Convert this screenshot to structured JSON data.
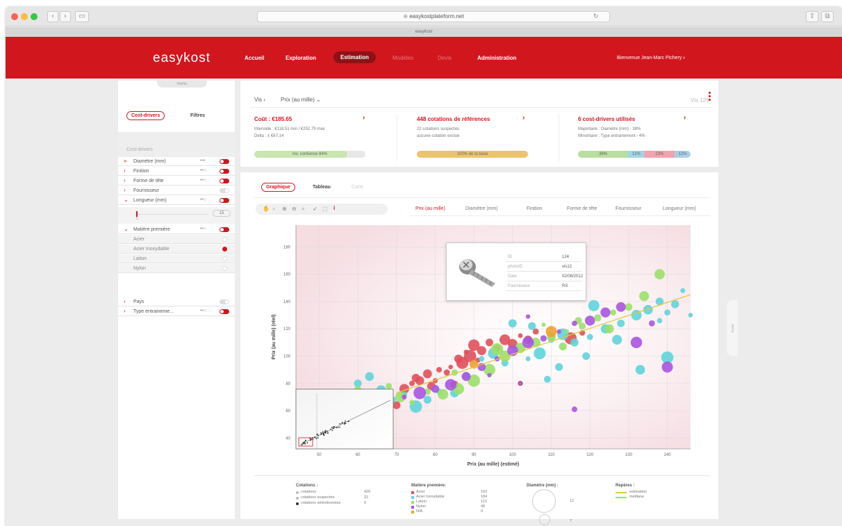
{
  "browser": {
    "url": "easykostplateform.net",
    "tab_title": "easyKost"
  },
  "header": {
    "logo": "easykost",
    "nav": [
      {
        "label": "Accueil",
        "state": "normal"
      },
      {
        "label": "Exploration",
        "state": "normal"
      },
      {
        "label": "Estimation",
        "state": "active"
      },
      {
        "label": "Modèles",
        "state": "disabled"
      },
      {
        "label": "Devis",
        "state": "disabled"
      },
      {
        "label": "Administration",
        "state": "normal"
      }
    ],
    "welcome": "Bienvenue Jean-Marc Pichery"
  },
  "left_panel": {
    "menu_tab": "menu",
    "tabs": {
      "cost_drivers": "Cost-drivers",
      "filters": "Filtres"
    },
    "section_title": "Cost-drivers",
    "drivers": [
      {
        "label": "Diamètre (mm)",
        "toggle": true,
        "dots": "•••"
      },
      {
        "label": "Finition",
        "toggle": true,
        "dots": "••○"
      },
      {
        "label": "Forme de tête",
        "toggle": true,
        "dots": "••○"
      },
      {
        "label": "Fournisseur",
        "toggle": false,
        "dots": ""
      },
      {
        "label": "Longueur (mm)",
        "toggle": true,
        "dots": "••○"
      }
    ],
    "range_min": "5",
    "range_max": "15",
    "material": {
      "label": "Matière première",
      "dots": "••○",
      "options": [
        {
          "label": "Acier",
          "selected": false
        },
        {
          "label": "Acier Inoxydable",
          "selected": true
        },
        {
          "label": "Laiton",
          "selected": false
        },
        {
          "label": "Nylon",
          "selected": false
        }
      ]
    },
    "drivers_after": [
      {
        "label": "Pays",
        "toggle": false,
        "dots": ""
      },
      {
        "label": "Type entraineme...",
        "toggle": true,
        "dots": "••○"
      }
    ]
  },
  "summary": {
    "breadcrumb_root": "Vis",
    "breadcrumb_current": "Prix (au mille)",
    "item_label": "Vis 125",
    "cost": {
      "title": "Coût : €185.65",
      "line1": "Intervalle : €118,51 min / €252,79 max",
      "line2": "Delta : ± €67,14",
      "bar": "niv. confiance 84%",
      "confidence": 84
    },
    "quotes": {
      "title": "448 cotations de références",
      "line1": "22 cotations suspectes",
      "line2": "aucune cotation exclue",
      "bar": "100% de la base"
    },
    "drivers": {
      "title": "6 cost-drivers utilisés",
      "line1": "Majoritaire : Diamètre (mm) - 38%",
      "line2": "Minoritaire : Type entrainement - 4%",
      "segments": [
        {
          "label": "38%",
          "share": 38,
          "color": "#b8dea0"
        },
        {
          "label": "12%",
          "share": 12,
          "color": "#9fd6e8"
        },
        {
          "label": "23%",
          "share": 23,
          "color": "#f1a3ad"
        },
        {
          "label": "12%",
          "share": 12,
          "color": "#a9cfe8"
        }
      ]
    }
  },
  "graph": {
    "view_tabs": [
      "Graphique",
      "Tableau",
      "Carte"
    ],
    "column_tabs": [
      "Prix (au mille)",
      "Diamètre (mm)",
      "Finition",
      "Forme de tête",
      "Fournisseur",
      "Longueur (mm)"
    ],
    "side_handle": "menu",
    "tooltip": {
      "rows": [
        {
          "key": "ID",
          "value": "124"
        },
        {
          "key": "photoID",
          "value": "vis12"
        },
        {
          "key": "Date",
          "value": "02/08/2012"
        },
        {
          "key": "Fournisseur",
          "value": "RS"
        }
      ]
    }
  },
  "chart_data": {
    "type": "scatter",
    "xlabel": "Prix (au mille) (estimé)",
    "ylabel": "Prix (au mille) (réel)",
    "xlim": [
      44,
      146
    ],
    "ylim": [
      32,
      196
    ],
    "xticks": [
      50,
      60,
      70,
      80,
      90,
      100,
      110,
      120,
      130,
      140
    ],
    "yticks": [
      40,
      60,
      80,
      100,
      120,
      140,
      160,
      180
    ],
    "grid": true,
    "trend_line": {
      "x": [
        70,
        146
      ],
      "y": [
        73,
        145
      ]
    },
    "series": [
      {
        "name": "Acier",
        "color": "#e0505a",
        "points": [
          [
            75,
            84
          ],
          [
            78,
            87
          ],
          [
            80,
            82
          ],
          [
            83,
            88
          ],
          [
            85,
            79
          ],
          [
            86,
            98
          ],
          [
            88,
            103
          ],
          [
            90,
            108
          ],
          [
            92,
            104
          ],
          [
            94,
            110
          ],
          [
            96,
            106
          ],
          [
            98,
            112
          ],
          [
            100,
            109
          ],
          [
            102,
            115
          ],
          [
            104,
            112
          ],
          [
            106,
            118
          ],
          [
            72,
            76
          ],
          [
            74,
            80
          ],
          [
            76,
            82
          ],
          [
            79,
            78
          ],
          [
            81,
            90
          ],
          [
            84,
            92
          ],
          [
            87,
            95
          ],
          [
            89,
            100
          ],
          [
            91,
            97
          ],
          [
            70,
            64
          ],
          [
            115,
            113
          ],
          [
            118,
            117
          ]
        ]
      },
      {
        "name": "Acier Inoxydable",
        "color": "#5fd4dc",
        "points": [
          [
            60,
            80
          ],
          [
            63,
            85
          ],
          [
            66,
            75
          ],
          [
            69,
            68
          ],
          [
            72,
            72
          ],
          [
            75,
            63
          ],
          [
            78,
            68
          ],
          [
            81,
            74
          ],
          [
            85,
            73
          ],
          [
            88,
            86
          ],
          [
            92,
            98
          ],
          [
            95,
            102
          ],
          [
            98,
            95
          ],
          [
            101,
            105
          ],
          [
            104,
            98
          ],
          [
            107,
            102
          ],
          [
            110,
            112
          ],
          [
            113,
            116
          ],
          [
            116,
            110
          ],
          [
            120,
            114
          ],
          [
            124,
            120
          ],
          [
            128,
            124
          ],
          [
            132,
            130
          ],
          [
            135,
            134
          ],
          [
            138,
            126
          ],
          [
            140,
            132
          ],
          [
            142,
            138
          ],
          [
            144,
            148
          ],
          [
            146,
            130
          ],
          [
            119,
            100
          ],
          [
            127,
            112
          ],
          [
            133,
            90
          ],
          [
            140,
            99
          ],
          [
            109,
            83
          ],
          [
            112,
            92
          ],
          [
            100,
            124
          ],
          [
            105,
            122
          ],
          [
            121,
            137
          ],
          [
            138,
            140
          ]
        ]
      },
      {
        "name": "Laiton",
        "color": "#9be06a",
        "points": [
          [
            60,
            75
          ],
          [
            64,
            72
          ],
          [
            68,
            78
          ],
          [
            71,
            70
          ],
          [
            74,
            66
          ],
          [
            78,
            74
          ],
          [
            82,
            72
          ],
          [
            86,
            76
          ],
          [
            90,
            82
          ],
          [
            94,
            90
          ],
          [
            98,
            100
          ],
          [
            102,
            106
          ],
          [
            106,
            110
          ],
          [
            110,
            114
          ],
          [
            114,
            118
          ],
          [
            118,
            122
          ],
          [
            122,
            128
          ],
          [
            126,
            132
          ],
          [
            130,
            136
          ],
          [
            134,
            144
          ],
          [
            138,
            160
          ],
          [
            85,
            88
          ],
          [
            96,
            105
          ],
          [
            108,
            123
          ],
          [
            117,
            126
          ],
          [
            125,
            120
          ],
          [
            113,
            107
          ]
        ]
      },
      {
        "name": "Nylon",
        "color": "#a855e0",
        "points": [
          [
            72,
            70
          ],
          [
            76,
            73
          ],
          [
            80,
            76
          ],
          [
            84,
            79
          ],
          [
            88,
            85
          ],
          [
            92,
            92
          ],
          [
            96,
            98
          ],
          [
            100,
            104
          ],
          [
            104,
            110
          ],
          [
            108,
            113
          ],
          [
            112,
            118
          ],
          [
            116,
            124
          ],
          [
            120,
            126
          ],
          [
            124,
            132
          ],
          [
            128,
            136
          ],
          [
            132,
            110
          ],
          [
            136,
            124
          ],
          [
            140,
            92
          ],
          [
            116,
            61
          ],
          [
            104,
            129
          ],
          [
            102,
            80
          ],
          [
            94,
            86
          ]
        ]
      },
      {
        "name": "N/A",
        "color": "#f0a030",
        "points": [
          [
            90,
            94
          ],
          [
            110,
            118
          ]
        ]
      }
    ],
    "legend": {
      "cotations": {
        "title": "Cotations :",
        "items": [
          {
            "label": "cotations",
            "count": "426"
          },
          {
            "label": "cotations suspectes",
            "count": "22"
          },
          {
            "label": "cotations sélectionnées",
            "count": "0"
          }
        ]
      },
      "materials": {
        "title": "Matière première:",
        "items": [
          {
            "label": "Acier",
            "count": "152",
            "color": "#e0505a"
          },
          {
            "label": "Acier Inoxydable",
            "count": "184",
            "color": "#5fd4dc"
          },
          {
            "label": "Laiton",
            "count": "113",
            "color": "#9be06a"
          },
          {
            "label": "Nylon",
            "count": "49",
            "color": "#a855e0"
          },
          {
            "label": "N/A",
            "count": "0",
            "color": "#f0a030"
          }
        ]
      },
      "diameter": {
        "title": "Diamètre (mm) :",
        "items": [
          {
            "label": "12"
          },
          {
            "label": "7"
          }
        ]
      },
      "marks": {
        "title": "Repères :",
        "items": [
          {
            "label": "estimation",
            "color": "#e2c93a"
          },
          {
            "label": "médiane",
            "color": "#9be06a"
          }
        ]
      }
    }
  }
}
